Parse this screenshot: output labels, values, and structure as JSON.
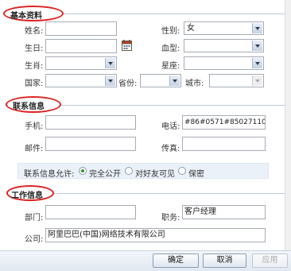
{
  "sections": {
    "basic": "基本资料",
    "contact": "联系信息",
    "work": "工作信息"
  },
  "basic": {
    "name_label": "姓名:",
    "name_value": "",
    "gender_label": "性别:",
    "gender_value": "女",
    "birthday_label": "生日:",
    "birthday_value": "",
    "blood_label": "血型:",
    "blood_value": "",
    "zodiac_label": "生肖:",
    "zodiac_value": "",
    "constellation_label": "星座:",
    "constellation_value": "",
    "country_label": "国家:",
    "country_value": "",
    "province_label": "省份:",
    "province_value": "",
    "city_label": "城市:",
    "city_value": ""
  },
  "contact": {
    "mobile_label": "手机:",
    "mobile_value": "",
    "phone_label": "电话:",
    "phone_value": "#86#0571#85027110",
    "email_label": "邮件:",
    "email_value": "",
    "fax_label": "传真:",
    "fax_value": "",
    "privacy_label": "联系信息允许:",
    "privacy_options": [
      "完全公开",
      "对好友可见",
      "保密"
    ],
    "privacy_selected": 0
  },
  "work": {
    "dept_label": "部门:",
    "dept_value": "",
    "position_label": "职务:",
    "position_value": "客户经理",
    "company_label": "公司:",
    "company_value": "阿里巴巴(中国)网络技术有限公司"
  },
  "buttons": {
    "ok": "确定",
    "cancel": "取消",
    "apply": "应用"
  },
  "colors": {
    "ellipse": "#d22222",
    "radio_selected": "#2a9a2a"
  },
  "icons": {
    "calendar": "calendar-icon",
    "dropdown": "chevron-down-icon"
  }
}
